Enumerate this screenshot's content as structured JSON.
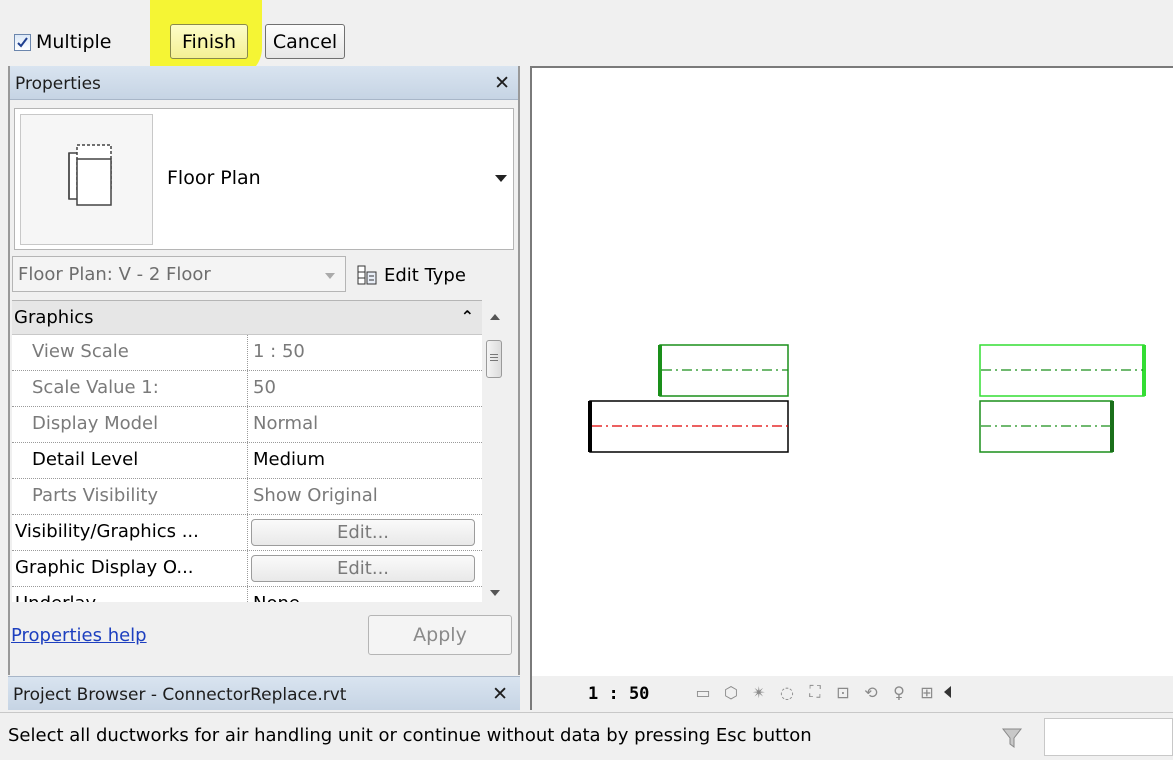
{
  "options_bar": {
    "multiple_label": "Multiple",
    "multiple_checked": true,
    "finish_label": "Finish",
    "cancel_label": "Cancel"
  },
  "properties": {
    "title": "Properties",
    "type_name": "Floor Plan",
    "instance_selector": "Floor Plan: V - 2 Floor",
    "edit_type_label": "Edit Type",
    "group_label": "Graphics",
    "rows": [
      {
        "key": "View Scale",
        "value": "1 : 50"
      },
      {
        "key": "Scale Value    1:",
        "value": "50"
      },
      {
        "key": "Display Model",
        "value": "Normal"
      },
      {
        "key": "Detail Level",
        "value": "Medium"
      },
      {
        "key": "Parts Visibility",
        "value": "Show Original"
      },
      {
        "key": "Visibility/Graphics ...",
        "value": "Edit..."
      },
      {
        "key": "Graphic Display O...",
        "value": "Edit..."
      },
      {
        "key": "Underlay",
        "value": "None"
      }
    ],
    "help_link": "Properties help",
    "apply_label": "Apply"
  },
  "project_browser": {
    "title": "Project Browser - ConnectorReplace.rvt"
  },
  "view_bar": {
    "scale": "1 : 50",
    "icons": [
      "detail-level-icon",
      "visual-style-icon",
      "sun-path-icon",
      "shadows-icon",
      "crop-view-icon",
      "show-crop-icon",
      "unlock-3d-icon",
      "temporary-hide-icon",
      "reveal-hidden-icon"
    ]
  },
  "status_bar": {
    "message": "Select all ductworks for air handling unit or continue without data by pressing Esc button"
  },
  "colors": {
    "highlight": "#f5f534",
    "duct_green": "#1a8f1a",
    "duct_light_green": "#33dd33",
    "centerline_red": "#e00000"
  }
}
